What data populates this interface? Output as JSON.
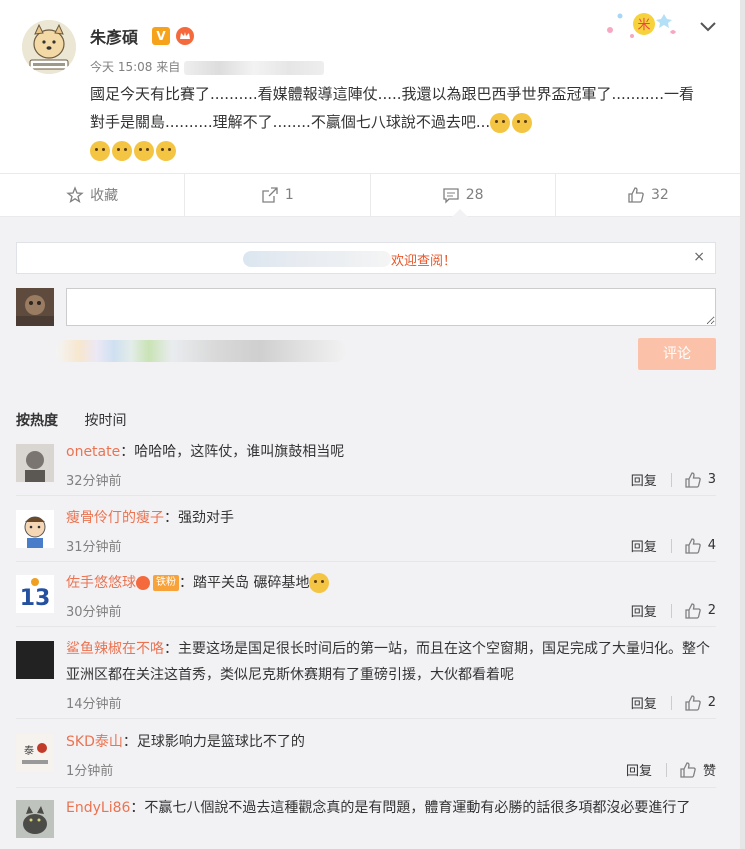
{
  "post": {
    "author": "朱彥碩",
    "time": "今天 15:08 来自",
    "text": "國足今天有比賽了..........看媒體報導這陣仗.....我還以為跟巴西爭世界盃冠軍了...........一看對手是關島..........理解不了........不贏個七八球說不過去吧...",
    "trailing_emoji_count": 6
  },
  "actions": {
    "favorite": {
      "label": "收藏"
    },
    "repost": {
      "count": "1"
    },
    "comment": {
      "count": "28"
    },
    "like": {
      "count": "32"
    }
  },
  "composer": {
    "notice_text": "欢迎查阅！",
    "notice_close": "×",
    "input_placeholder": "",
    "submit_label": "评论"
  },
  "sort": {
    "hot": "按热度",
    "time": "按时间"
  },
  "comments": [
    {
      "name": "onetate",
      "text": "：哈哈哈，这阵仗，谁叫旗鼓相当呢",
      "time": "32分钟前",
      "reply": "回复",
      "likes": "3"
    },
    {
      "name": "瘦骨伶仃的瘦子",
      "text": "：强劲对手",
      "time": "31分钟前",
      "reply": "回复",
      "likes": "4"
    },
    {
      "name": "佐手悠悠球",
      "badge": "铁粉",
      "text": "：踏平关岛 碾碎基地",
      "time": "30分钟前",
      "reply": "回复",
      "likes": "2"
    },
    {
      "name": "鲨鱼辣椒在不咯",
      "text": "：主要这场是国足很长时间后的第一站，而且在这个空窗期，国足完成了大量归化。整个亚洲区都在关注这首秀，类似尼克斯休赛期有了重磅引援，大伙都看着呢",
      "time": "14分钟前",
      "reply": "回复",
      "likes": "2"
    },
    {
      "name": "SKD泰山",
      "text": "：足球影响力是篮球比不了的",
      "time": "1分钟前",
      "reply": "回复",
      "likes": "赞"
    },
    {
      "name": "EndyLi86",
      "text": "：不赢七八個說不過去這種觀念真的是有問題，體育運動有必勝的話很多項都沒必要進行了",
      "time": "",
      "reply": "",
      "likes": ""
    }
  ],
  "colors": {
    "accent": "#eb7350",
    "notice": "#e8562a",
    "submit": "#fcc2a9"
  }
}
